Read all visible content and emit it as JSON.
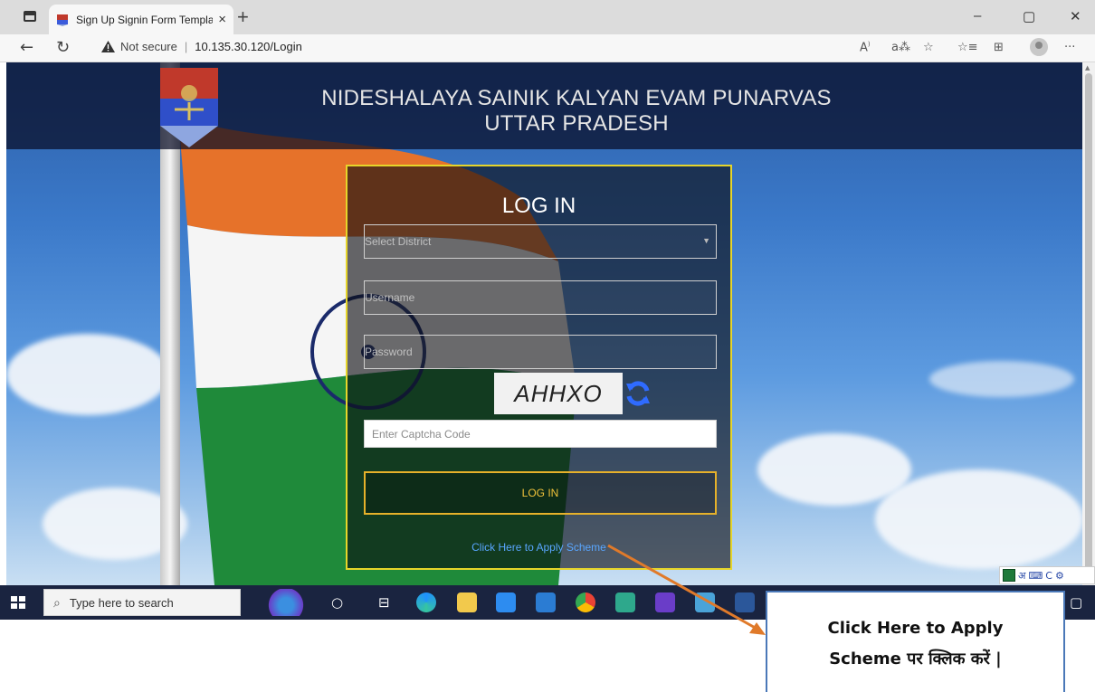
{
  "browser": {
    "tab_title": "Sign Up Signin Form Template E",
    "tab_close": "×",
    "new_tab": "+",
    "not_secure": "Not secure",
    "url": "10.135.30.120/Login",
    "window_controls": {
      "minimize": "–",
      "maximize": "▢",
      "close": "✕"
    },
    "toolbar_icons": [
      "read-aloud-icon",
      "translate-icon",
      "favorite-add-icon",
      "favorites-icon",
      "collections-icon",
      "profile-icon",
      "more-icon"
    ]
  },
  "page": {
    "header_line1": "NIDESHALAYA SAINIK KALYAN EVAM PUNARVAS",
    "header_line2": "UTTAR PRADESH"
  },
  "login": {
    "title": "LOG IN",
    "district_placeholder": "Select District",
    "username_placeholder": "Username",
    "password_placeholder": "Password",
    "captcha_text": "AHHXO",
    "captcha_placeholder": "Enter Captcha Code",
    "button_label": "LOG IN",
    "apply_link": "Click Here to Apply Scheme"
  },
  "taskbar": {
    "search_placeholder": "Type here to search"
  },
  "ime": {
    "label": "अ",
    "c_label": "C"
  },
  "callout": {
    "line1": "Click Here to Apply",
    "line2": "Scheme पर क्लिक करें |"
  },
  "colors": {
    "login_border": "#e6d52a",
    "login_button_border": "#e6b12a",
    "link": "#59a6ff",
    "callout_border": "#4a78b8",
    "arrow": "#e07a2a"
  }
}
